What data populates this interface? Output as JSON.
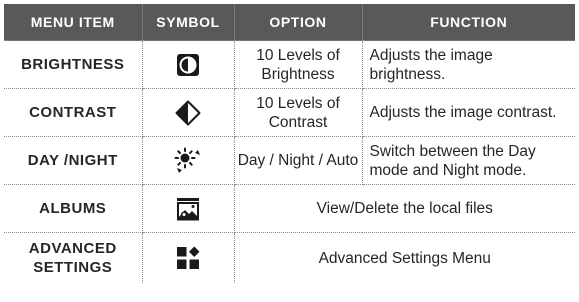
{
  "table": {
    "headers": [
      "MENU ITEM",
      "SYMBOL",
      "OPTION",
      "FUNCTION"
    ],
    "rows": [
      {
        "item": "BRIGHTNESS",
        "icon": "brightness-icon",
        "option": "10 Levels of Brightness",
        "function": "Adjusts the image brightness."
      },
      {
        "item": "CONTRAST",
        "icon": "contrast-icon",
        "option": "10 Levels of Contrast",
        "function": "Adjusts the image contrast."
      },
      {
        "item": "DAY /NIGHT",
        "icon": "day-night-icon",
        "option": "Day / Night / Auto",
        "function": "Switch between the Day mode and Night mode."
      },
      {
        "item": "ALBUMS",
        "icon": "albums-icon",
        "description": "View/Delete the local files"
      },
      {
        "item": "ADVANCED SETTINGS",
        "icon": "advanced-settings-icon",
        "description": "Advanced Settings Menu"
      }
    ]
  },
  "colors": {
    "header_bg": "#58595b",
    "header_text": "#ffffff",
    "text": "#262626",
    "icon": "#1a1a1a"
  }
}
